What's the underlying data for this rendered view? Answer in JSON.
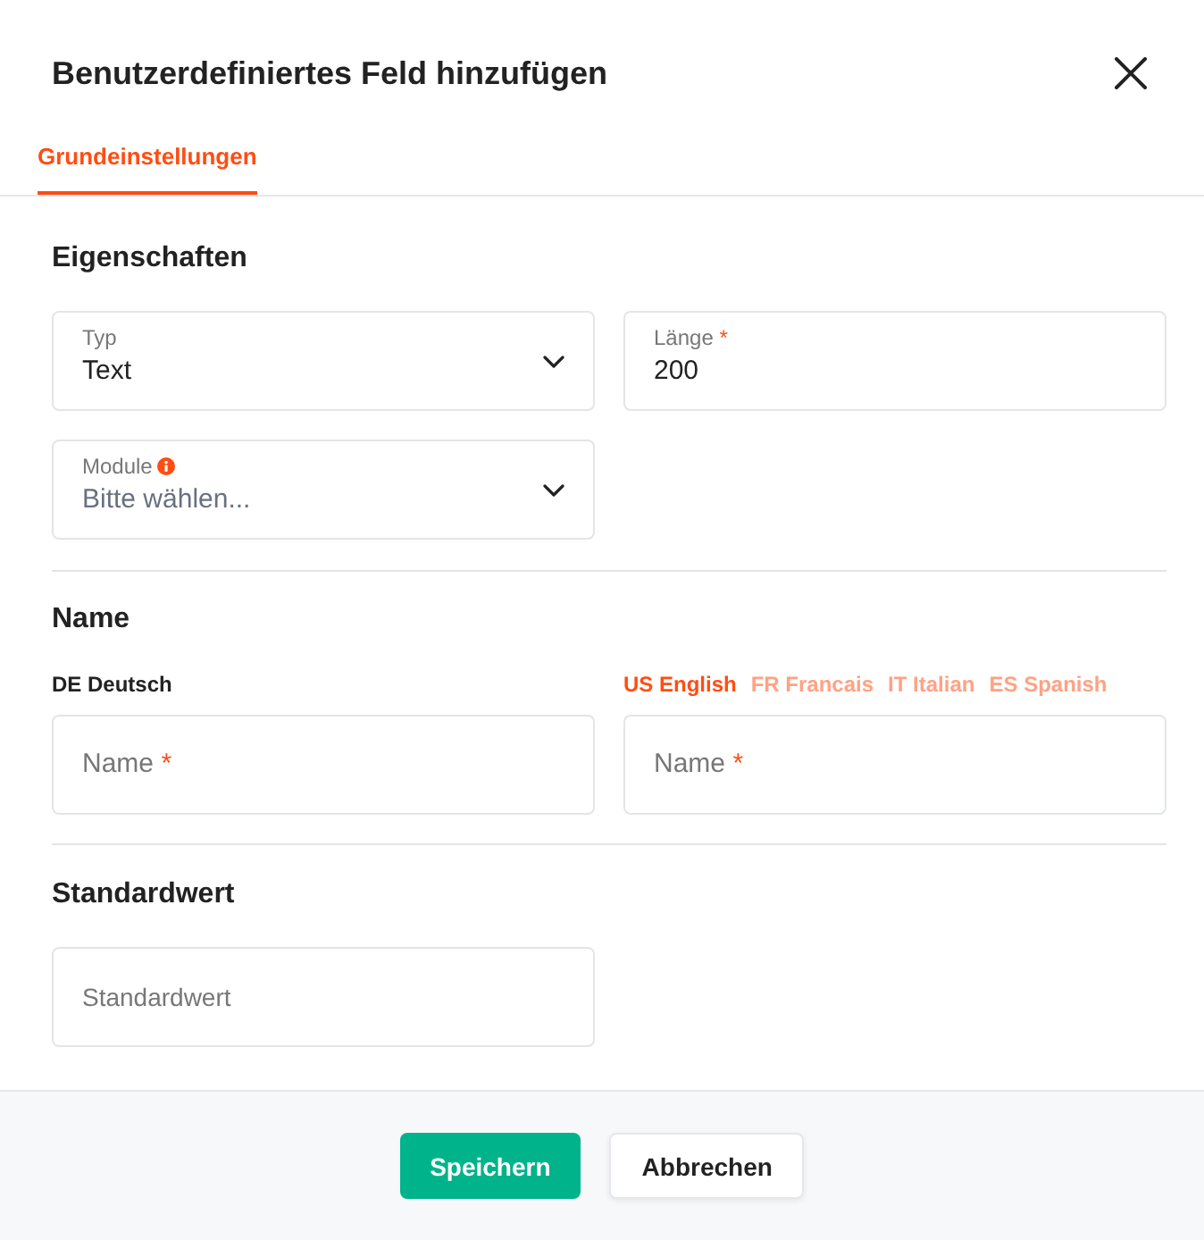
{
  "dialog": {
    "title": "Benutzerdefiniertes Feld hinzufügen"
  },
  "tabs": [
    {
      "label": "Grundeinstellungen",
      "selected": true
    }
  ],
  "properties": {
    "heading": "Eigenschaften",
    "fields": [
      {
        "kind": "select",
        "label": "Typ",
        "value": "Text"
      },
      {
        "kind": "input",
        "label": "Länge",
        "required_mark": "*",
        "value": "200"
      },
      {
        "kind": "select",
        "label": "Module",
        "info": true,
        "placeholder": "Bitte wählen..."
      }
    ]
  },
  "name": {
    "heading": "Name",
    "source_language": "DE Deutsch",
    "languages": [
      {
        "label": "US English",
        "selected": true
      },
      {
        "label": "FR Francais",
        "selected": false
      },
      {
        "label": "IT Italian",
        "selected": false
      },
      {
        "label": "ES Spanish",
        "selected": false
      }
    ],
    "fields": [
      {
        "placeholder": "Name",
        "required_mark": "*"
      },
      {
        "placeholder": "Name",
        "required_mark": "*"
      }
    ]
  },
  "default_value": {
    "heading": "Standardwert",
    "field": {
      "placeholder": "Standardwert"
    }
  },
  "buttons": [
    {
      "label": "Speichern",
      "kind": "primary"
    },
    {
      "label": "Abbrechen",
      "kind": "secondary"
    }
  ]
}
